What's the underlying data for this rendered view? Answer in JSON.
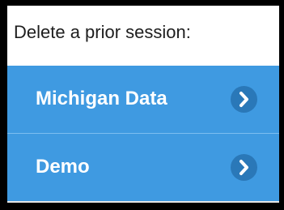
{
  "header": {
    "title": "Delete a prior session:"
  },
  "sessions": [
    {
      "label": "Michigan Data",
      "icon": "chevron-right-icon"
    },
    {
      "label": "Demo",
      "icon": "chevron-right-icon"
    }
  ],
  "colors": {
    "accent": "#3f9ae1",
    "chip": "#2a78b8",
    "divider": "#7cbdf0",
    "border": "#000000"
  }
}
